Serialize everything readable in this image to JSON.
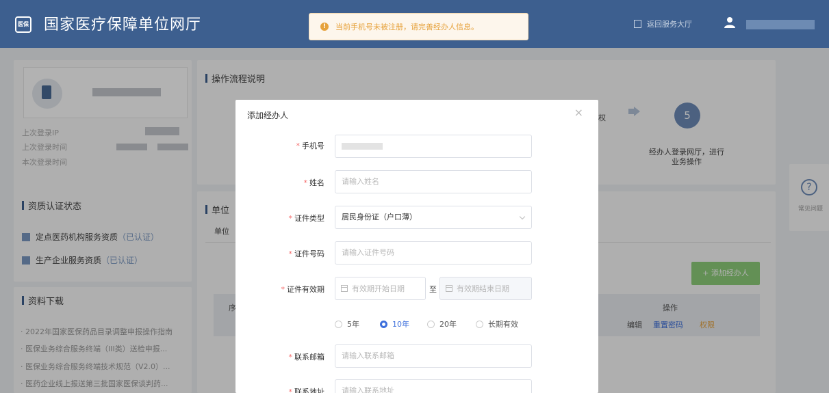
{
  "header": {
    "logo_text": "医保",
    "title": "国家医疗保障单位网厅",
    "toast": "当前手机号未被注册，请完善经办人信息。",
    "back_label": "返回服务大厅"
  },
  "left": {
    "login_info": [
      "上次登录IP",
      "上次登录时间",
      "本次登录时间"
    ],
    "qual_title": "资质认证状态",
    "qual_items": [
      {
        "label": "定点医药机构服务资质",
        "status": "（已认证）"
      },
      {
        "label": "生产企业服务资质",
        "status": "（已认证）"
      }
    ],
    "download_title": "资料下载",
    "downloads": [
      "· 2022年国家医保药品目录调整申报操作指南",
      "· 医保业务综合服务终端（III类）送检申报...",
      "· 医保业务综合服务终端技术规范（V2.0）...",
      "· 医药企业线上报送第三批国家医保谈判药..."
    ]
  },
  "main": {
    "flow_title": "操作流程说明",
    "step_number": "5",
    "step4_tail": "权",
    "step5_text": "经办人登录网厅，进行业务操作",
    "unit_title": "单位",
    "unit_tab": "单位",
    "add_button": "+ 添加经办人",
    "col_seq": "序",
    "col_ops": "操作",
    "ops": {
      "edit": "编辑",
      "reset": "重置密码",
      "perm": "权限"
    }
  },
  "help": {
    "label": "常见问题",
    "icon": "?"
  },
  "modal": {
    "title": "添加经办人",
    "close": "×",
    "fields": {
      "phone": {
        "label": "手机号"
      },
      "name": {
        "label": "姓名",
        "placeholder": "请输入姓名"
      },
      "id_type": {
        "label": "证件类型",
        "value": "居民身份证（户口薄）"
      },
      "id_number": {
        "label": "证件号码",
        "placeholder": "请输入证件号码"
      },
      "validity": {
        "label": "证件有效期",
        "start_placeholder": "有效期开始日期",
        "to": "至",
        "end_placeholder": "有效期结束日期"
      },
      "email": {
        "label": "联系邮箱",
        "placeholder": "请输入联系邮箱"
      },
      "address": {
        "label": "联系地址",
        "placeholder": "请输入联系地址"
      }
    },
    "validity_options": [
      "5年",
      "10年",
      "20年",
      "长期有效"
    ],
    "validity_selected": "10年"
  },
  "colors": {
    "header": "#3d5f8f",
    "accent": "#3d6fdc",
    "toast": "#e6a23c",
    "add_button": "#8fcf7a"
  }
}
